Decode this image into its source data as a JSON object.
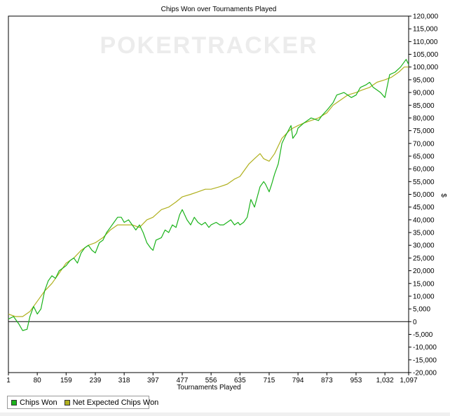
{
  "chart_data": {
    "type": "line",
    "title": "Chips Won over Tournaments Played",
    "xlabel": "Tournaments Played",
    "ylabel": "$",
    "watermark": "POKERTRACKER",
    "x_ticks": [
      "1",
      "80",
      "159",
      "239",
      "318",
      "397",
      "477",
      "556",
      "635",
      "715",
      "794",
      "873",
      "953",
      "1,032",
      "1,097"
    ],
    "xlim": [
      1,
      1097
    ],
    "ylim": [
      -20000,
      120000
    ],
    "y_ticks": [
      -20000,
      -15000,
      -10000,
      -5000,
      0,
      5000,
      10000,
      15000,
      20000,
      25000,
      30000,
      35000,
      40000,
      45000,
      50000,
      55000,
      60000,
      65000,
      70000,
      75000,
      80000,
      85000,
      90000,
      95000,
      100000,
      105000,
      110000,
      115000,
      120000
    ],
    "y_tick_labels": [
      "-20,000",
      "-15,000",
      "-10,000",
      "-5,000",
      "0",
      "5,000",
      "10,000",
      "15,000",
      "20,000",
      "25,000",
      "30,000",
      "35,000",
      "40,000",
      "45,000",
      "50,000",
      "55,000",
      "60,000",
      "65,000",
      "70,000",
      "75,000",
      "80,000",
      "85,000",
      "90,000",
      "95,000",
      "100,000",
      "105,000",
      "110,000",
      "115,000",
      "120,000"
    ],
    "grid": false,
    "legend_position": "bottom-left",
    "series": [
      {
        "name": "Chips Won",
        "color": "#1bb31b",
        "x": [
          1,
          15,
          30,
          40,
          52,
          60,
          70,
          80,
          90,
          100,
          110,
          120,
          130,
          140,
          150,
          159,
          170,
          180,
          190,
          200,
          210,
          220,
          230,
          239,
          250,
          260,
          270,
          280,
          290,
          300,
          310,
          318,
          330,
          340,
          350,
          360,
          370,
          380,
          390,
          397,
          405,
          420,
          430,
          440,
          450,
          460,
          470,
          477,
          490,
          500,
          510,
          520,
          530,
          540,
          550,
          556,
          570,
          580,
          590,
          600,
          610,
          620,
          630,
          635,
          645,
          655,
          665,
          675,
          690,
          700,
          705,
          715,
          722,
          730,
          740,
          750,
          760,
          775,
          780,
          790,
          794,
          810,
          830,
          850,
          860,
          873,
          890,
          900,
          920,
          940,
          953,
          965,
          980,
          990,
          1000,
          1010,
          1020,
          1032,
          1045,
          1060,
          1075,
          1090,
          1097
        ],
        "y": [
          1000,
          2000,
          -1000,
          -3500,
          -3000,
          2000,
          6000,
          3000,
          5000,
          12000,
          16000,
          18000,
          17000,
          20000,
          21000,
          22000,
          24000,
          25000,
          23000,
          27000,
          29000,
          30000,
          28000,
          27000,
          31000,
          32000,
          35000,
          37000,
          39000,
          41000,
          41000,
          39000,
          40000,
          38000,
          36000,
          38000,
          35000,
          31000,
          29000,
          28000,
          32000,
          33000,
          36000,
          35000,
          38000,
          37000,
          42000,
          44000,
          40000,
          38000,
          41000,
          39000,
          38000,
          39000,
          37000,
          38000,
          39000,
          38000,
          38000,
          39000,
          40000,
          38000,
          39000,
          38000,
          39000,
          41000,
          48000,
          45000,
          53000,
          55000,
          54000,
          51000,
          54000,
          58000,
          62000,
          70000,
          73000,
          77000,
          72000,
          74000,
          76000,
          78000,
          80000,
          79000,
          81000,
          83000,
          86000,
          89000,
          90000,
          88000,
          89000,
          92000,
          93000,
          94000,
          92000,
          91000,
          90000,
          88000,
          97000,
          98000,
          100000,
          103000,
          101000
        ]
      },
      {
        "name": "Net Expected Chips Won",
        "color": "#b0b01e",
        "x": [
          1,
          20,
          40,
          60,
          80,
          100,
          120,
          140,
          159,
          180,
          200,
          220,
          239,
          260,
          280,
          300,
          318,
          340,
          360,
          380,
          397,
          420,
          440,
          460,
          477,
          500,
          520,
          540,
          556,
          580,
          600,
          620,
          635,
          650,
          660,
          675,
          690,
          700,
          715,
          730,
          750,
          770,
          780,
          794,
          810,
          830,
          850,
          873,
          890,
          910,
          930,
          953,
          970,
          990,
          1010,
          1032,
          1050,
          1070,
          1085,
          1097
        ],
        "y": [
          3000,
          2000,
          2000,
          4000,
          8000,
          12000,
          15000,
          19000,
          23000,
          25000,
          28000,
          30000,
          31000,
          33000,
          36000,
          38000,
          38000,
          38000,
          37000,
          40000,
          41000,
          44000,
          45000,
          47000,
          49000,
          50000,
          51000,
          52000,
          52000,
          53000,
          54000,
          56000,
          57000,
          60000,
          62000,
          64000,
          66000,
          64000,
          63000,
          66000,
          72000,
          75000,
          76000,
          77000,
          78000,
          79000,
          80000,
          82000,
          85000,
          87000,
          89000,
          90000,
          91000,
          92000,
          94000,
          95000,
          96000,
          98000,
          100000,
          100000
        ]
      }
    ]
  }
}
